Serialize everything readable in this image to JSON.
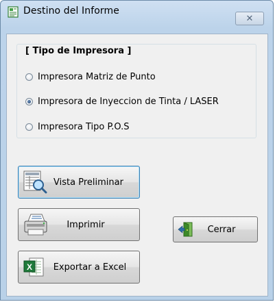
{
  "window": {
    "title": "Destino del Informe",
    "close_symbol": "✕"
  },
  "printer_group": {
    "title": "[ Tipo de Impresora ]",
    "options": [
      {
        "label": "Impresora Matriz de Punto",
        "selected": false
      },
      {
        "label": "Impresora de Inyeccion de Tinta / LASER",
        "selected": true
      },
      {
        "label": "Impresora Tipo  P.O.S",
        "selected": false
      }
    ]
  },
  "buttons": {
    "preview": "Vista Preliminar",
    "print": "Imprimir",
    "excel": "Exportar a Excel",
    "close": "Cerrar"
  },
  "icons": {
    "app": "report-document-icon",
    "preview": "magnifier-report-icon",
    "print": "printer-icon",
    "excel": "excel-icon",
    "close": "door-exit-icon"
  }
}
